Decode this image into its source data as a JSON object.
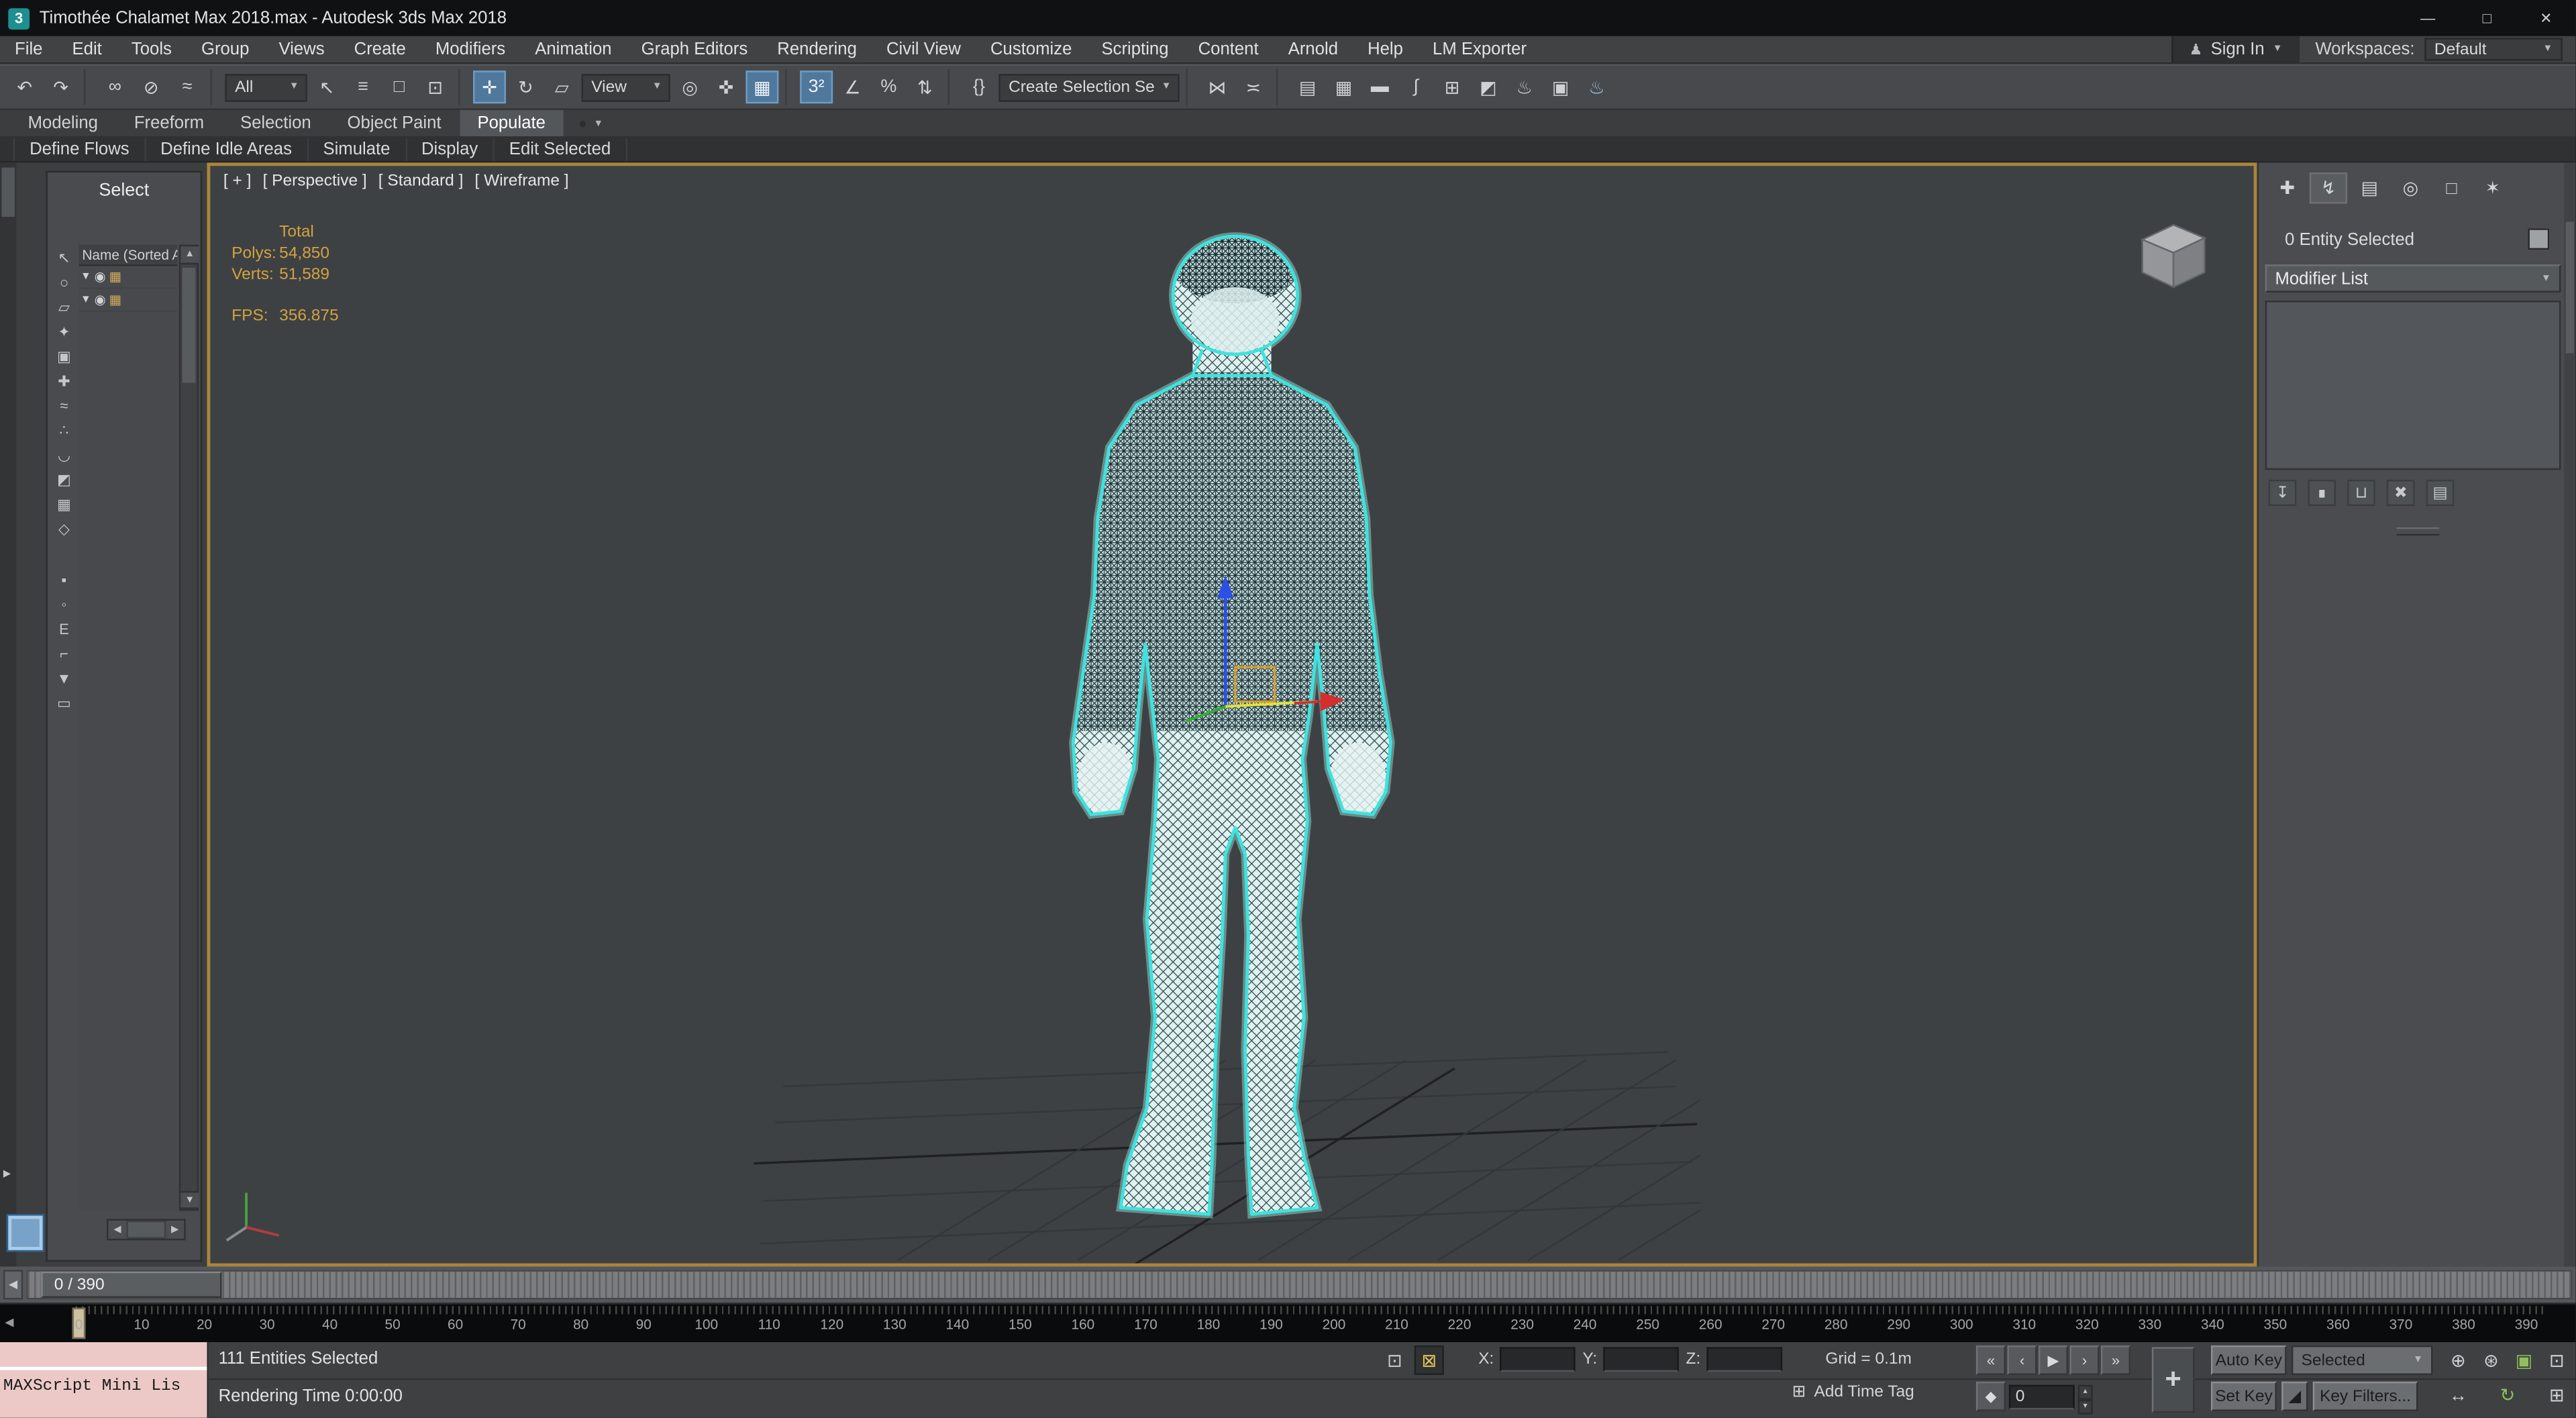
{
  "window": {
    "title": "Timothée Chalamet Max 2018.max - Autodesk 3ds Max 2018",
    "logo_letter": "3",
    "minimize_glyph": "—",
    "maximize_glyph": "□",
    "close_glyph": "✕"
  },
  "icons": {
    "chevron_down": "▼",
    "chevron_small": "▾",
    "user": "♟",
    "overflow_dot": "●"
  },
  "menu_bar": {
    "items": [
      "File",
      "Edit",
      "Tools",
      "Group",
      "Views",
      "Create",
      "Modifiers",
      "Animation",
      "Graph Editors",
      "Rendering",
      "Civil View",
      "Customize",
      "Scripting",
      "Content",
      "Arnold",
      "Help",
      "LM Exporter"
    ],
    "sign_in_label": "Sign In",
    "workspaces_label": "Workspaces:",
    "workspace_value": "Default"
  },
  "main_toolbar": {
    "items": [
      {
        "n": "undo-button",
        "g": "↶"
      },
      {
        "n": "redo-button",
        "g": "↷"
      },
      {
        "t": "s"
      },
      {
        "n": "select-and-link-button",
        "g": "∞"
      },
      {
        "n": "unlink-selection-button",
        "g": "⊘"
      },
      {
        "n": "bind-to-space-warp-button",
        "g": "≈"
      },
      {
        "t": "s"
      },
      {
        "t": "d",
        "n": "selection-filter-dropdown",
        "label": "All",
        "w": 50
      },
      {
        "n": "select-object-button",
        "g": "↖"
      },
      {
        "n": "select-by-name-button",
        "g": "≡"
      },
      {
        "n": "selection-region-button",
        "g": "□"
      },
      {
        "n": "window-crossing-toggle",
        "g": "⊡"
      },
      {
        "t": "s"
      },
      {
        "n": "select-and-move-button",
        "g": "✛",
        "on": true
      },
      {
        "n": "select-and-rotate-button",
        "g": "↻"
      },
      {
        "n": "select-and-scale-button",
        "g": "▱"
      },
      {
        "t": "d",
        "n": "reference-coordinate-dropdown",
        "label": "View",
        "w": 54
      },
      {
        "n": "use-pivot-center-button",
        "g": "◎"
      },
      {
        "n": "select-and-manipulate-button",
        "g": "✜"
      },
      {
        "n": "keyboard-override-toggle",
        "g": "▦",
        "on": true
      },
      {
        "t": "s"
      },
      {
        "n": "snaps-toggle",
        "g": "3²",
        "on": true
      },
      {
        "n": "angle-snap-toggle",
        "g": "∠"
      },
      {
        "n": "percent-snap-toggle",
        "g": "%"
      },
      {
        "n": "spinner-snap-toggle",
        "g": "⇅"
      },
      {
        "t": "s"
      },
      {
        "n": "edit-named-selection-sets-button",
        "g": "{}"
      },
      {
        "t": "d",
        "n": "named-selection-sets-dropdown",
        "label": "Create Selection Se",
        "w": 110
      },
      {
        "t": "s"
      },
      {
        "n": "mirror-button",
        "g": "⋈"
      },
      {
        "n": "align-button",
        "g": "≍"
      },
      {
        "t": "s"
      },
      {
        "n": "toggle-scene-explorer-button",
        "g": "▤"
      },
      {
        "n": "toggle-layer-explorer-button",
        "g": "▦"
      },
      {
        "n": "toggle-ribbon-button",
        "g": "▬"
      },
      {
        "n": "curve-editor-button",
        "g": "∫"
      },
      {
        "n": "schematic-view-button",
        "g": "⊞"
      },
      {
        "n": "material-editor-button",
        "g": "◩"
      },
      {
        "n": "render-setup-button",
        "g": "♨"
      },
      {
        "n": "rendered-frame-window-button",
        "g": "▣"
      },
      {
        "n": "render-production-button",
        "g": "♨",
        "c": "#9fc5e8"
      }
    ]
  },
  "ribbon": {
    "tabs": [
      {
        "label": "Modeling"
      },
      {
        "label": "Freeform"
      },
      {
        "label": "Selection"
      },
      {
        "label": "Object Paint"
      },
      {
        "label": "Populate",
        "active": true
      }
    ],
    "tools": [
      "Define Flows",
      "Define Idle Areas",
      "Simulate",
      "Display",
      "Edit Selected"
    ]
  },
  "left_dock": {
    "expand_arrow": "▶"
  },
  "scene_explorer": {
    "title": "Select",
    "column_header": "Name (Sorted A",
    "side_icons": [
      {
        "n": "select-display-icon",
        "g": "↖"
      },
      {
        "n": "display-geometry-icon",
        "g": "○"
      },
      {
        "n": "display-shapes-icon",
        "g": "▱"
      },
      {
        "n": "display-lights-icon",
        "g": "✦"
      },
      {
        "n": "display-cameras-icon",
        "g": "▣"
      },
      {
        "n": "display-helpers-icon",
        "g": "✚"
      },
      {
        "n": "display-spacewarps-icon",
        "g": "≈"
      },
      {
        "n": "display-particles-icon",
        "g": "∴"
      },
      {
        "n": "display-bones-icon",
        "g": "◡"
      },
      {
        "n": "display-materials-icon",
        "g": "◩"
      },
      {
        "n": "display-groups-icon",
        "g": "▦"
      },
      {
        "n": "display-xrefs-icon",
        "g": "◇"
      }
    ],
    "side_icons2": [
      {
        "n": "display-frozen-icon",
        "g": "▪"
      },
      {
        "n": "display-hidden-icon",
        "g": "◦"
      },
      {
        "n": "letter-e-panel-icon",
        "g": "E"
      },
      {
        "n": "selection-set-icon",
        "g": "⌐"
      },
      {
        "n": "filter-icon",
        "g": "▼"
      },
      {
        "n": "containers-icon",
        "g": "▭"
      }
    ],
    "rows": [
      {
        "expand": "▼",
        "eye": "◉",
        "type": "▦"
      },
      {
        "expand": "▼",
        "eye": "◉",
        "type": "▦"
      }
    ],
    "v_up": "▲",
    "v_down": "▼",
    "h_left": "◀",
    "h_right": "▶"
  },
  "viewport": {
    "menus": [
      {
        "n": "viewport-general-menu",
        "label": "[ + ]"
      },
      {
        "n": "viewport-pov-menu",
        "label": "[ Perspective ]"
      },
      {
        "n": "viewport-standard-menu",
        "label": "[ Standard ]"
      },
      {
        "n": "viewport-shading-menu",
        "label": "[ Wireframe ]"
      }
    ],
    "stats": {
      "total_label": "Total",
      "polys_label": "Polys:",
      "polys_value": "54,850",
      "verts_label": "Verts:",
      "verts_value": "51,589",
      "fps_label": "FPS:",
      "fps_value": "356.875"
    }
  },
  "command_panel": {
    "tabs": [
      {
        "n": "create-tab",
        "g": "✚"
      },
      {
        "n": "modify-tab",
        "g": "↯",
        "on": true
      },
      {
        "n": "hierarchy-tab",
        "g": "▤"
      },
      {
        "n": "motion-tab",
        "g": "◎"
      },
      {
        "n": "display-tab",
        "g": "□"
      },
      {
        "n": "utilities-tab",
        "g": "✶"
      }
    ],
    "selection_info": "0 Entity Selected",
    "modifier_list_label": "Modifier List",
    "stack_buttons": [
      {
        "n": "pin-stack-button",
        "g": "↧"
      },
      {
        "n": "show-end-result-button",
        "g": "∎"
      },
      {
        "n": "make-unique-button",
        "g": "⊔"
      },
      {
        "n": "remove-modifier-button",
        "g": "✖"
      },
      {
        "n": "configure-modifier-sets-button",
        "g": "▤"
      }
    ]
  },
  "timeline": {
    "slider_label": "0 / 390",
    "slider_left_arrow": "◀",
    "ruler": {
      "start": 0,
      "end": 390,
      "step": 10,
      "marker_frame": 0,
      "left_arrow": "◀"
    }
  },
  "status_bar": {
    "mini_listener_text": "MAXScript Mini Lis",
    "status_line": "111 Entities Selected",
    "prompt_line": "Rendering Time  0:00:00",
    "toggles": [
      {
        "n": "isolate-selection-toggle",
        "g": "⊡"
      },
      {
        "n": "selection-lock-toggle",
        "g": "⊠",
        "on": true
      }
    ],
    "x_label": "X:",
    "x_value": "",
    "y_label": "Y:",
    "y_value": "",
    "z_label": "Z:",
    "z_value": "",
    "grid_label": "Grid = 0.1m",
    "time_tag_icon": "⊞",
    "time_tag_label": "Add Time Tag",
    "playback": [
      {
        "n": "go-to-start-button",
        "g": "«"
      },
      {
        "n": "previous-frame-button",
        "g": "‹"
      },
      {
        "n": "play-button",
        "g": "▶"
      },
      {
        "n": "next-frame-button",
        "g": "›"
      },
      {
        "n": "go-to-end-button",
        "g": "»"
      }
    ],
    "key_mode_glyph": "◆",
    "frame_value": "0",
    "spin_up": "▴",
    "spin_down": "▾",
    "add_keys_glyph": "+",
    "auto_key_label": "Auto Key",
    "set_key_label": "Set Key",
    "tangent_glyph": "◢",
    "selection_set_value": "Selected",
    "key_filters_label": "Key Filters...",
    "nav1": [
      {
        "n": "zoom-button",
        "g": "⊕"
      },
      {
        "n": "zoom-all-button",
        "g": "⊛"
      },
      {
        "n": "zoom-extents-button",
        "g": "▣",
        "c": "#8fbf5f"
      },
      {
        "n": "zoom-region-button",
        "g": "⊡"
      }
    ],
    "nav2": [
      {
        "n": "pan-button",
        "g": "↔"
      },
      {
        "n": "orbit-button",
        "g": "↻",
        "c": "#8fbf5f"
      },
      {
        "n": "maximize-viewport-button",
        "g": "⊞"
      }
    ]
  }
}
